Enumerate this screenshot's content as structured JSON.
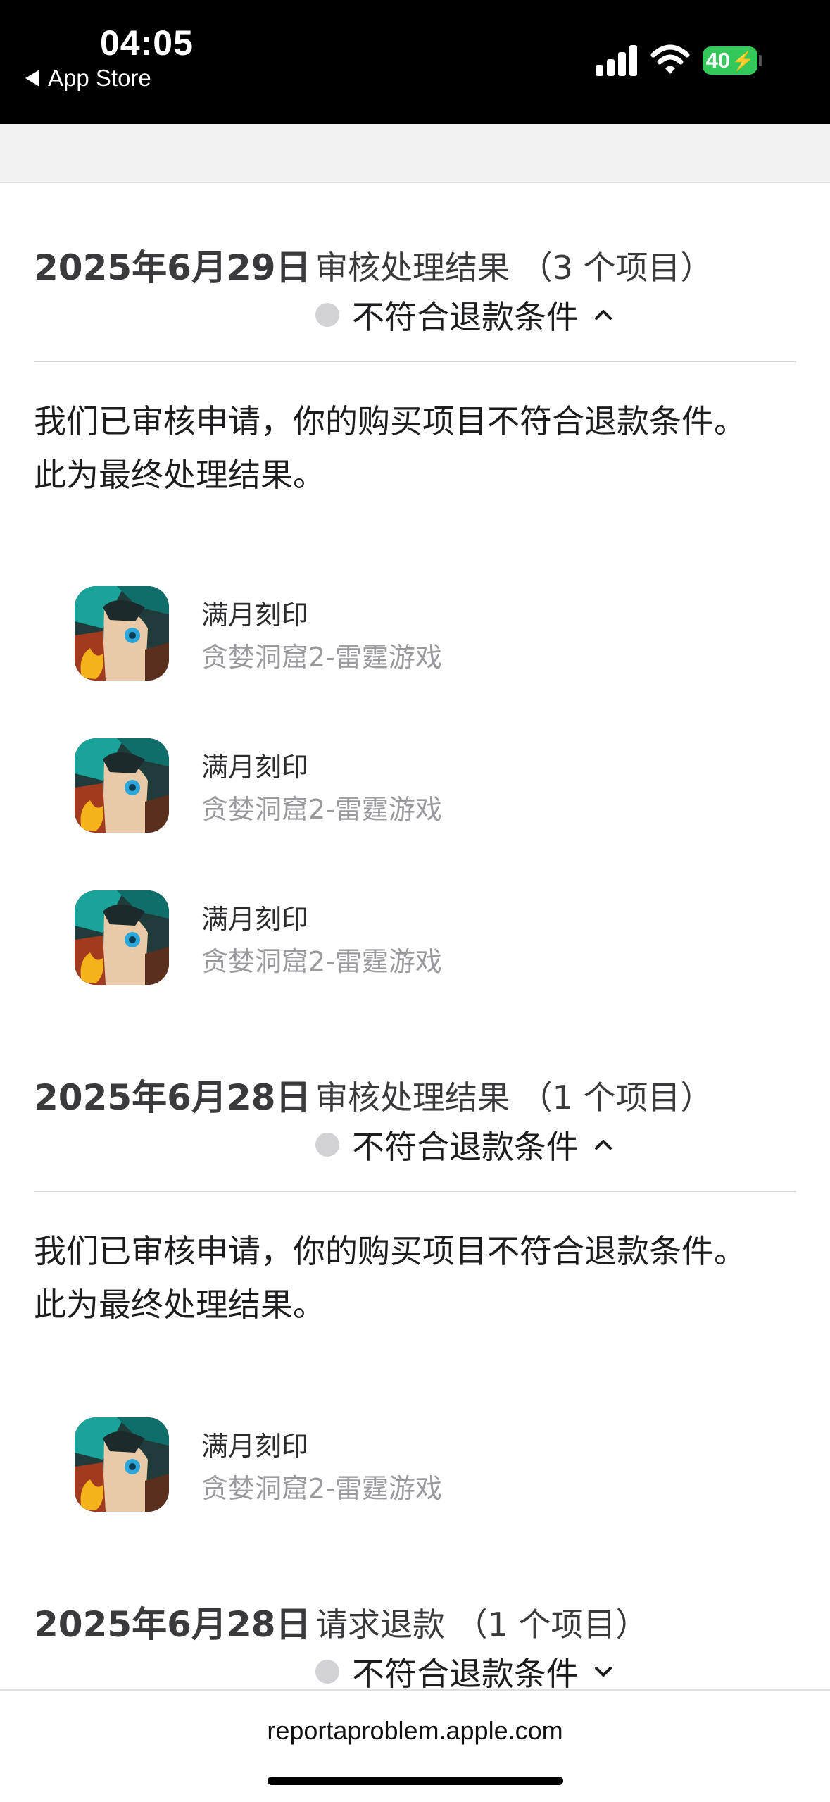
{
  "status_bar": {
    "time": "04:05",
    "back_label": "App Store",
    "battery": "40"
  },
  "sections": [
    {
      "date": "2025年6月29日",
      "title": "审核处理结果 （3 个项目）",
      "status": "不符合退款条件",
      "expanded": true,
      "message_line1": "我们已审核申请，你的购买项目不符合退款条件。",
      "message_line2": "此为最终处理结果。",
      "items": [
        {
          "name": "满月刻印",
          "sub": "贪婪洞窟2-雷霆游戏"
        },
        {
          "name": "满月刻印",
          "sub": "贪婪洞窟2-雷霆游戏"
        },
        {
          "name": "满月刻印",
          "sub": "贪婪洞窟2-雷霆游戏"
        }
      ]
    },
    {
      "date": "2025年6月28日",
      "title": "审核处理结果 （1 个项目）",
      "status": "不符合退款条件",
      "expanded": true,
      "message_line1": "我们已审核申请，你的购买项目不符合退款条件。",
      "message_line2": "此为最终处理结果。",
      "items": [
        {
          "name": "满月刻印",
          "sub": "贪婪洞窟2-雷霆游戏"
        }
      ]
    },
    {
      "date": "2025年6月28日",
      "title": "请求退款 （1 个项目）",
      "status": "不符合退款条件",
      "expanded": false
    }
  ],
  "footer": {
    "url": "reportaproblem.apple.com"
  },
  "colors": {
    "battery": "#34c759",
    "dot": "#d1d1d6",
    "secondary_text": "#9a9a9e"
  }
}
